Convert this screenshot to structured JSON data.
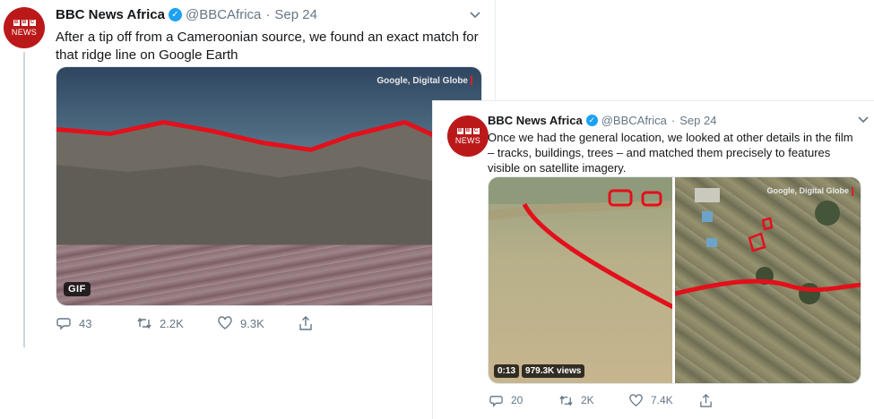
{
  "tweets": [
    {
      "name": "BBC News Africa",
      "handle": "@BBCAfrica",
      "date": "Sep 24",
      "text": "After a tip off from a Cameroonian source, we found an exact match for that ridge line on Google Earth",
      "media": {
        "credit": "Google, Digital Globe",
        "badge": "GIF"
      },
      "counts": {
        "replies": "43",
        "retweets": "2.2K",
        "likes": "9.3K"
      }
    },
    {
      "name": "BBC News Africa",
      "handle": "@BBCAfrica",
      "date": "Sep 24",
      "text": "Once we had the general location, we looked at other details in the film – tracks, buildings, trees – and matched them precisely to features visible on satellite imagery.",
      "media": {
        "credit": "Google, Digital Globe",
        "duration": "0:13",
        "views": "979.3K views"
      },
      "counts": {
        "replies": "20",
        "retweets": "2K",
        "likes": "7.4K"
      }
    }
  ],
  "avatar": {
    "blocks": [
      "B",
      "B",
      "C"
    ],
    "label": "NEWS"
  },
  "colors": {
    "brand_red": "#bb1919",
    "verified_blue": "#1da1f2",
    "muted": "#657786",
    "annotation_red": "#e3101b"
  },
  "icons": [
    "reply-icon",
    "retweet-icon",
    "like-icon",
    "share-icon",
    "verified-icon",
    "chevron-down-icon"
  ]
}
